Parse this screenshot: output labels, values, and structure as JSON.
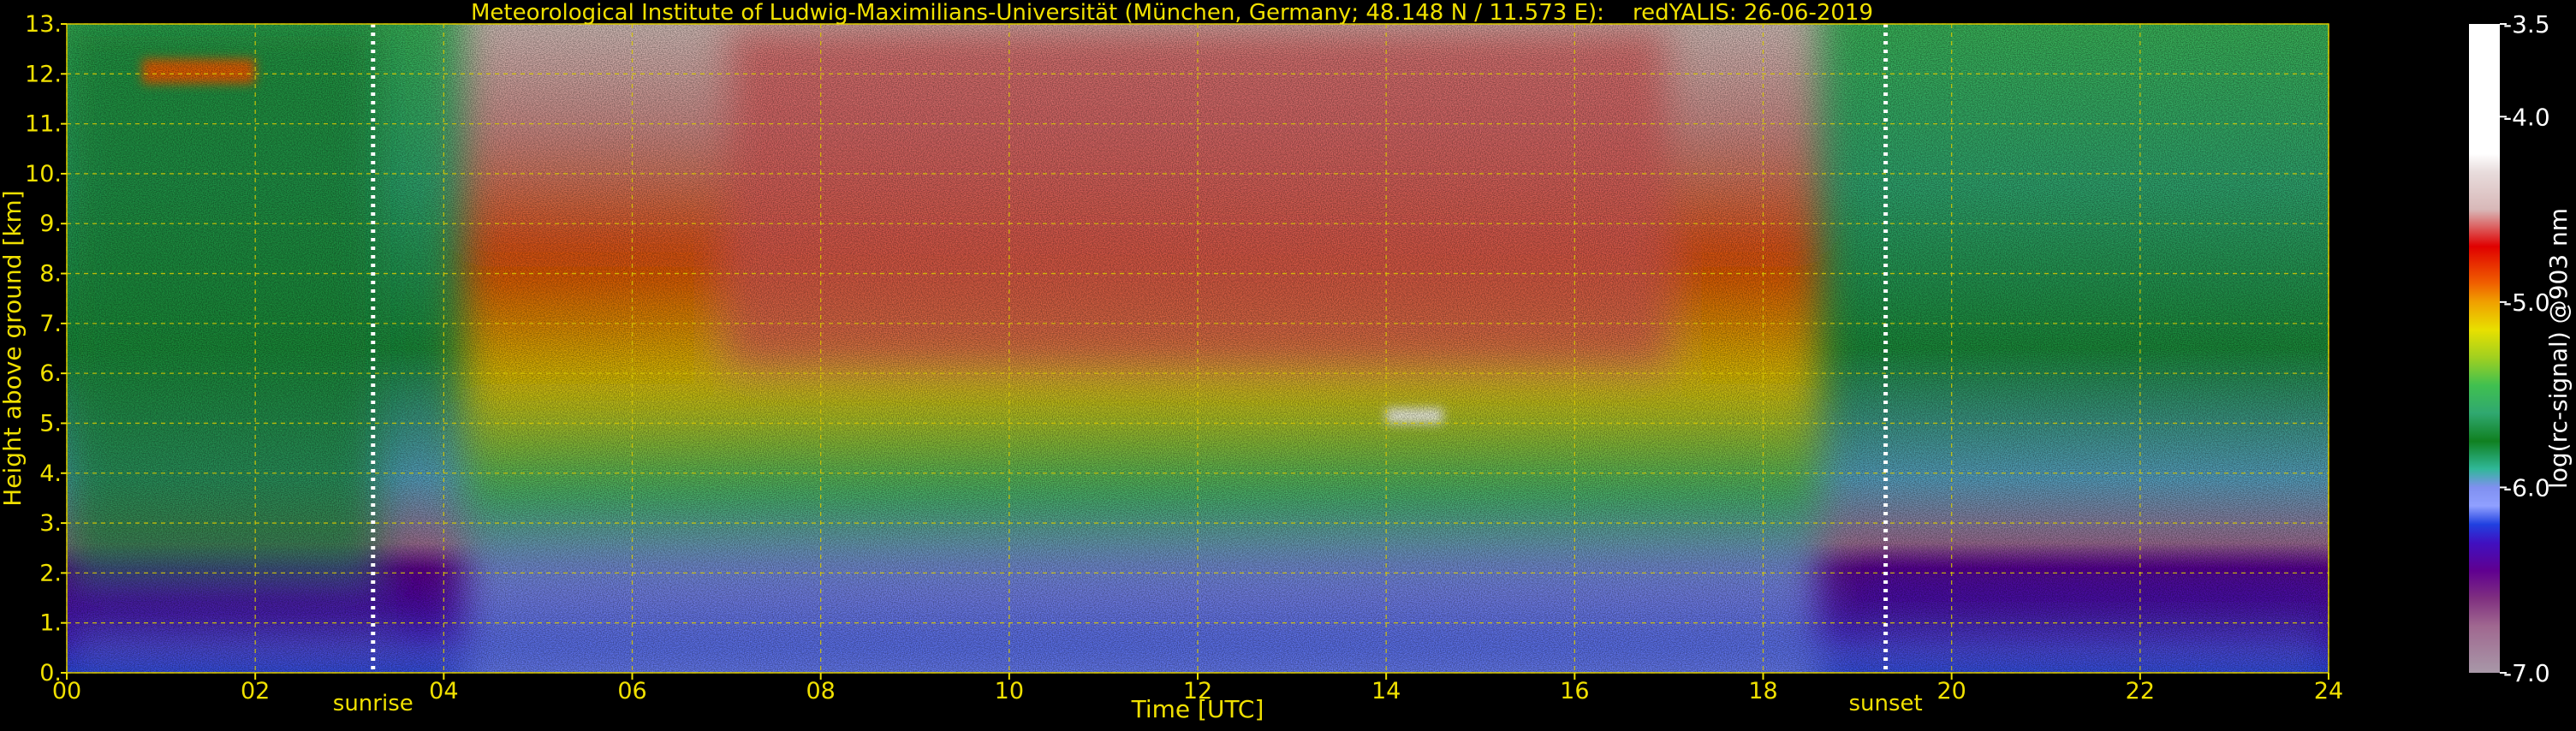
{
  "chart_data": {
    "type": "heatmap",
    "title": "Meteorological Institute of Ludwig-Maximilians-Universität (München, Germany; 48.148 N / 11.573 E):    redYALIS: 26-06-2019",
    "xlabel": "Time [UTC]",
    "ylabel": "Height above ground [km]",
    "xlim": [
      0,
      24
    ],
    "ylim": [
      0,
      13
    ],
    "x_ticks": [
      {
        "value": 0,
        "label": "00"
      },
      {
        "value": 2,
        "label": "02"
      },
      {
        "value": 4,
        "label": "04"
      },
      {
        "value": 6,
        "label": "06"
      },
      {
        "value": 8,
        "label": "08"
      },
      {
        "value": 10,
        "label": "10"
      },
      {
        "value": 12,
        "label": "12"
      },
      {
        "value": 14,
        "label": "14"
      },
      {
        "value": 16,
        "label": "16"
      },
      {
        "value": 18,
        "label": "18"
      },
      {
        "value": 20,
        "label": "20"
      },
      {
        "value": 22,
        "label": "22"
      },
      {
        "value": 24,
        "label": "24"
      }
    ],
    "y_ticks": [
      {
        "value": 0,
        "label": "0."
      },
      {
        "value": 1,
        "label": "1."
      },
      {
        "value": 2,
        "label": "2."
      },
      {
        "value": 3,
        "label": "3."
      },
      {
        "value": 4,
        "label": "4."
      },
      {
        "value": 5,
        "label": "5."
      },
      {
        "value": 6,
        "label": "6."
      },
      {
        "value": 7,
        "label": "7."
      },
      {
        "value": 8,
        "label": "8."
      },
      {
        "value": 9,
        "label": "9."
      },
      {
        "value": 10,
        "label": "10."
      },
      {
        "value": 11,
        "label": "11."
      },
      {
        "value": 12,
        "label": "12."
      },
      {
        "value": 13,
        "label": "13."
      }
    ],
    "grid": true,
    "markers": [
      {
        "name": "sunrise",
        "x": 3.25,
        "label": "sunrise"
      },
      {
        "name": "sunset",
        "x": 19.3,
        "label": "sunset"
      }
    ],
    "colorbar": {
      "label": "log(rc-signal) @903 nm",
      "range": [
        -7.0,
        -3.5
      ],
      "ticks": [
        {
          "value": -3.5,
          "label": "-3.5"
        },
        {
          "value": -4.0,
          "label": "-4.0"
        },
        {
          "value": -5.0,
          "label": "-5.0"
        },
        {
          "value": -6.0,
          "label": "-6.0"
        },
        {
          "value": -7.0,
          "label": "-7.0"
        }
      ],
      "stops": [
        {
          "value": -3.5,
          "color": "#ffffff"
        },
        {
          "value": -4.2,
          "color": "#ffffff"
        },
        {
          "value": -4.3,
          "color": "#e8dcdc"
        },
        {
          "value": -4.5,
          "color": "#d8b8b8"
        },
        {
          "value": -4.7,
          "color": "#e00000"
        },
        {
          "value": -4.9,
          "color": "#f06000"
        },
        {
          "value": -5.0,
          "color": "#f0a000"
        },
        {
          "value": -5.15,
          "color": "#e8e000"
        },
        {
          "value": -5.3,
          "color": "#a0d020"
        },
        {
          "value": -5.45,
          "color": "#40c050"
        },
        {
          "value": -5.6,
          "color": "#30a870"
        },
        {
          "value": -5.75,
          "color": "#108020"
        },
        {
          "value": -5.9,
          "color": "#30b898"
        },
        {
          "value": -6.0,
          "color": "#8090f0"
        },
        {
          "value": -6.1,
          "color": "#90a0ff"
        },
        {
          "value": -6.2,
          "color": "#2040e0"
        },
        {
          "value": -6.3,
          "color": "#4010c0"
        },
        {
          "value": -6.45,
          "color": "#600090"
        },
        {
          "value": -6.6,
          "color": "#803080"
        },
        {
          "value": -6.75,
          "color": "#a06890"
        },
        {
          "value": -7.0,
          "color": "#a898a8"
        }
      ]
    },
    "regions": [
      {
        "name": "boundary-layer-band",
        "x": [
          0,
          24
        ],
        "y": [
          0,
          0.7
        ],
        "value": -6.15
      },
      {
        "name": "residual-layer",
        "x": [
          0,
          3.5
        ],
        "y": [
          0.7,
          2.0
        ],
        "value": -6.35
      },
      {
        "name": "evening-layer",
        "x": [
          19,
          24
        ],
        "y": [
          0.9,
          2.0
        ],
        "value": -6.35
      },
      {
        "name": "nighttime-upper-air",
        "x": [
          0,
          3.3
        ],
        "y": [
          2.0,
          13
        ],
        "value": -5.7
      },
      {
        "name": "daytime-upper-air",
        "x": [
          7,
          17
        ],
        "y": [
          6,
          13
        ],
        "value": -4.6
      },
      {
        "name": "cirrus-cloud",
        "x": [
          0.8,
          2.0
        ],
        "y": [
          11.8,
          12.3
        ],
        "value": -4.9
      },
      {
        "name": "cloud-patch",
        "x": [
          14.0,
          14.6
        ],
        "y": [
          5.0,
          5.3
        ],
        "value": -3.6
      }
    ]
  },
  "colors": {
    "background": "#000000",
    "text": "#f0e000",
    "grid": "#d8c800",
    "marker": "#ffffff",
    "colorbar_text": "#ffffff"
  }
}
